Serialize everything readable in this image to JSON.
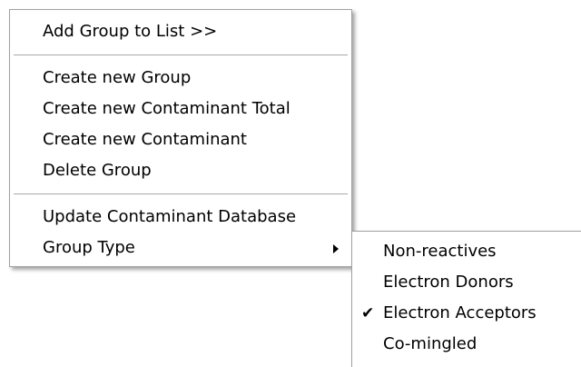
{
  "context_menu": {
    "items": [
      {
        "label": "Add Group to List >>"
      },
      {
        "label": "Create new Group"
      },
      {
        "label": "Create new Contaminant Total"
      },
      {
        "label": "Create new Contaminant"
      },
      {
        "label": "Delete Group"
      },
      {
        "label": "Update Contaminant Database"
      },
      {
        "label": "Group Type",
        "has_submenu": true
      }
    ]
  },
  "group_type_submenu": {
    "items": [
      {
        "label": "Non-reactives",
        "checked": false
      },
      {
        "label": "Electron Donors",
        "checked": false
      },
      {
        "label": "Electron Acceptors",
        "checked": true
      },
      {
        "label": "Co-mingled",
        "checked": false
      }
    ],
    "check_glyph": "✔"
  }
}
